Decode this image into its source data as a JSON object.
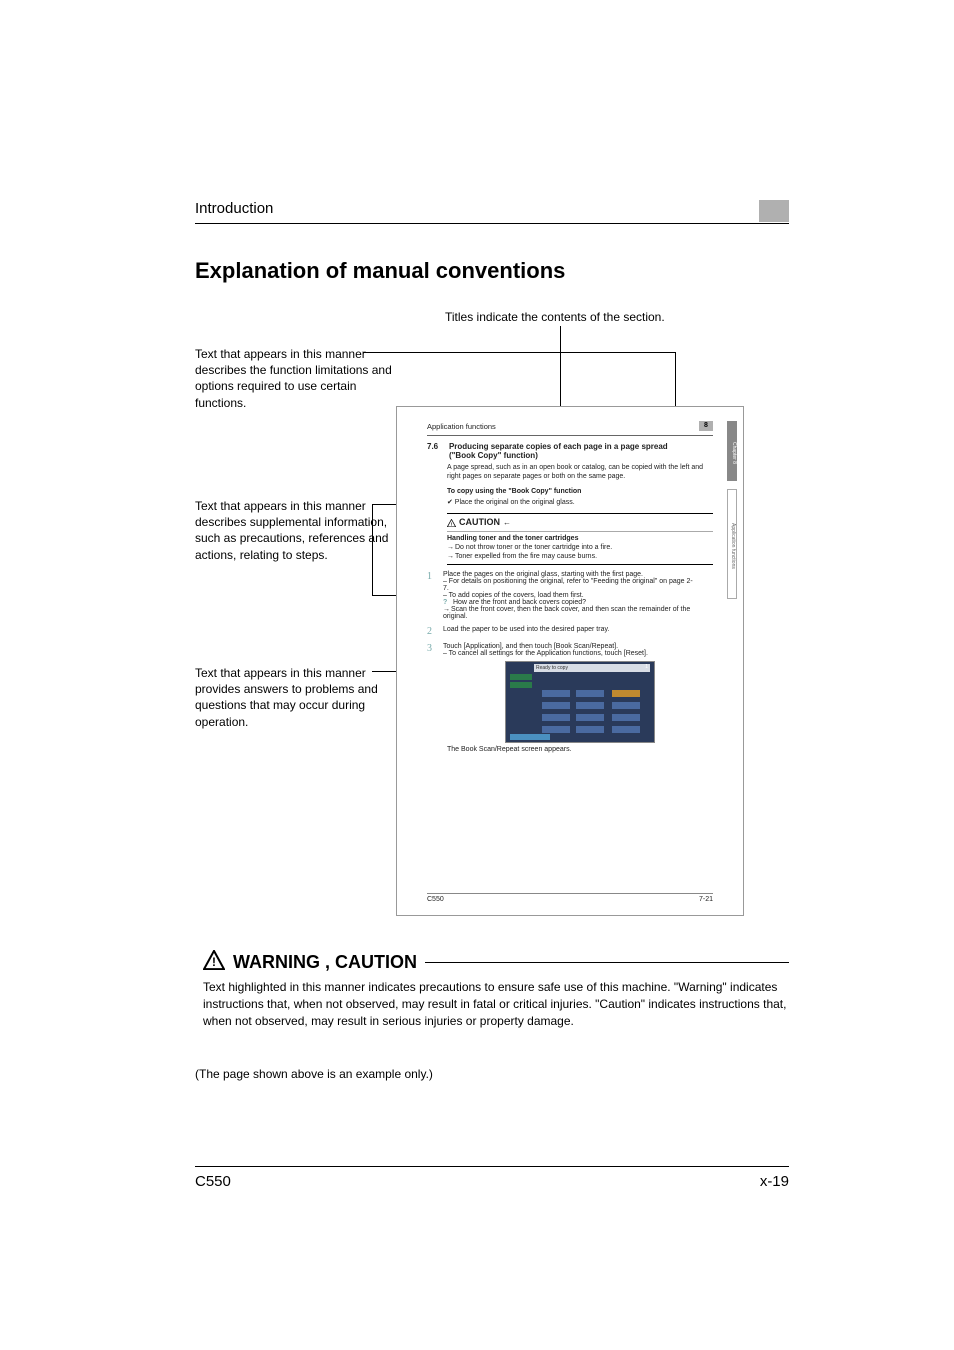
{
  "header": {
    "intro": "Introduction"
  },
  "section_title": "Explanation of manual conventions",
  "diagram": {
    "titles_caption": "Titles indicate the contents of the section.",
    "left1": "Text that appears in this manner describes the function limitations and options required to use certain functions.",
    "left2": "Text that appears in this manner describes supplemental information, such as precautions, references and actions, relating to steps.",
    "left3": "Text that appears in this manner provides answers to problems and questions that may occur during operation."
  },
  "sample": {
    "app_func": "Application functions",
    "box8": "8",
    "secnum": "7.6",
    "sectitle": "Producing separate copies of each page in a page spread (\"Book Copy\" function)",
    "body1": "A page spread, such as in an open book or catalog, can be copied with the left and right pages on separate pages or both on the same page.",
    "subhead": "To copy using the \"Book Copy\" function",
    "check_line": "✔  Place the original on the original glass.",
    "caution_label": "CAUTION",
    "caution_sub": "Handling toner and the toner cartridges",
    "caution_l1": "Do not throw toner or the toner cartridge into a fire.",
    "caution_l2": "Toner expelled from the fire may cause burns.",
    "step1": "Place the pages on the original glass, starting with the first page.",
    "step1a": "For details on positioning the original, refer to \"Feeding the original\" on page 2-7.",
    "step1b": "To add copies of the covers, load them first.",
    "step1q": "How are the front and back covers copied?",
    "step1ans": "Scan the front cover, then the back cover, and then scan the remainder of the original.",
    "step2": "Load the paper to be used into the desired paper tray.",
    "step3": "Touch [Application], and then touch [Book Scan/Repeat].",
    "step3a": "To cancel all settings for the Application functions, touch [Reset].",
    "ready": "Ready to copy",
    "after_shot": "The Book Scan/Repeat screen appears.",
    "footer_left": "C550",
    "footer_right": "7-21",
    "sidetab1": "Chapter 8",
    "sidetab2": "Application functions"
  },
  "warning": {
    "title": "WARNING , CAUTION",
    "desc": "Text highlighted in this manner indicates precautions to ensure safe use of this machine. \"Warning\" indicates instructions that, when not observed, may result in fatal or critical injuries. \"Caution\" indicates instructions that, when not observed, may result in serious injuries or property damage."
  },
  "example_note": "(The page shown above is an example only.)",
  "footer": {
    "left": "C550",
    "right": "x-19"
  }
}
